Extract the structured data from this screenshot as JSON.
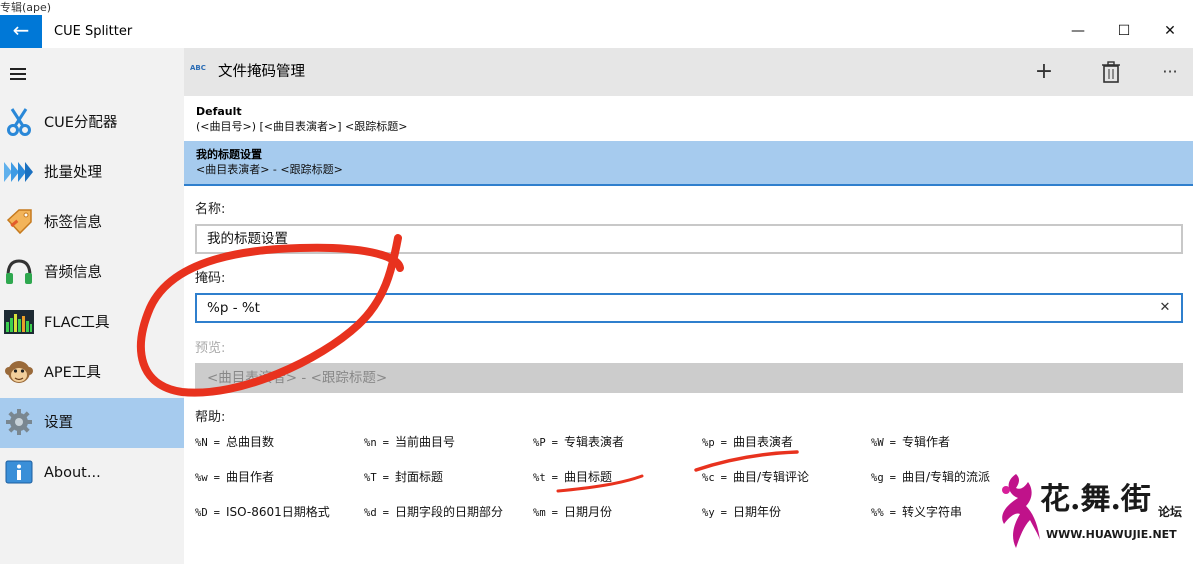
{
  "behind_window_title": "专辑(ape)",
  "titlebar": {
    "back_icon": "back-arrow-icon",
    "title": "CUE Splitter",
    "minimize": "—",
    "maximize": "☐",
    "close": "✕"
  },
  "sidebar": {
    "items": [
      {
        "label": "CUE分配器",
        "icon": "scissors-icon"
      },
      {
        "label": "批量处理",
        "icon": "batch-arrows-icon"
      },
      {
        "label": "标签信息",
        "icon": "tag-icon"
      },
      {
        "label": "音频信息",
        "icon": "headphones-icon"
      },
      {
        "label": "FLAC工具",
        "icon": "equalizer-icon"
      },
      {
        "label": "APE工具",
        "icon": "monkey-icon"
      },
      {
        "label": "设置",
        "icon": "gear-icon"
      },
      {
        "label": "About...",
        "icon": "info-icon"
      }
    ],
    "active_index": 6
  },
  "page": {
    "icon_text": "ABC",
    "title": "文件掩码管理",
    "add_icon": "+",
    "delete_icon": "🗑",
    "more_icon": "···"
  },
  "list": [
    {
      "name": "Default",
      "mask": "(<曲目号>) [<曲目表演者>] <跟踪标题>"
    },
    {
      "name": "我的标题设置",
      "mask": "<曲目表演者> - <跟踪标题>"
    }
  ],
  "form": {
    "name_label": "名称:",
    "name_value": "我的标题设置",
    "mask_label": "掩码:",
    "mask_value": "%p - %t",
    "clear_icon": "✕",
    "preview_label": "预览:",
    "preview_value": "<曲目表演者> - <跟踪标题>",
    "help_label": "帮助:"
  },
  "help": [
    {
      "code": "%N",
      "desc": "总曲目数"
    },
    {
      "code": "%n",
      "desc": "当前曲目号"
    },
    {
      "code": "%P",
      "desc": "专辑表演者"
    },
    {
      "code": "%p",
      "desc": "曲目表演者"
    },
    {
      "code": "%W",
      "desc": "专辑作者"
    },
    {
      "code": "%w",
      "desc": "曲目作者"
    },
    {
      "code": "%T",
      "desc": "封面标题"
    },
    {
      "code": "%t",
      "desc": "曲目标题"
    },
    {
      "code": "%c",
      "desc": "曲目/专辑评论"
    },
    {
      "code": "%g",
      "desc": "曲目/专辑的流派"
    },
    {
      "code": "%D",
      "desc": "ISO-8601日期格式"
    },
    {
      "code": "%d",
      "desc": "日期字段的日期部分"
    },
    {
      "code": "%m",
      "desc": "日期月份"
    },
    {
      "code": "%y",
      "desc": "日期年份"
    },
    {
      "code": "%%",
      "desc": "转义字符串"
    }
  ],
  "help_equals": "=",
  "watermark": {
    "text": "花.舞.街",
    "forum": "论坛",
    "url": "WWW.HUAWUJIE.NET"
  },
  "colors": {
    "accent": "#0078d7",
    "selection": "#a6cbee",
    "annotation": "#e8321e"
  }
}
